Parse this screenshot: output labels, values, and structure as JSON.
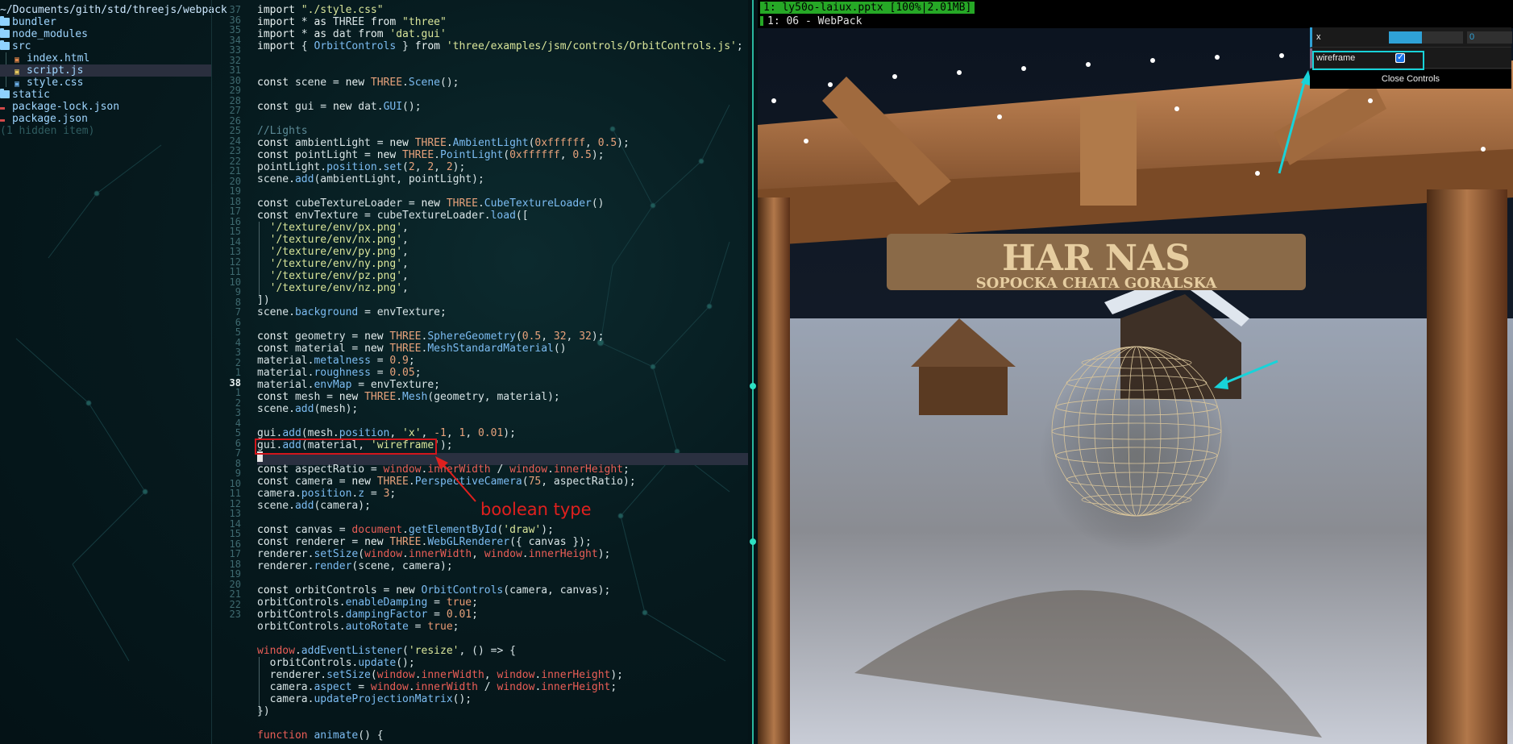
{
  "file_tree": {
    "root": "~/Documents/gith/std/threejs/webpack",
    "items": [
      {
        "label": "bundler",
        "kind": "folder"
      },
      {
        "label": "node_modules",
        "kind": "folder"
      },
      {
        "label": "src",
        "kind": "folder"
      },
      {
        "label": "index.html",
        "kind": "file"
      },
      {
        "label": "script.js",
        "kind": "file",
        "selected": true
      },
      {
        "label": "style.css",
        "kind": "file"
      },
      {
        "label": "static",
        "kind": "folder"
      },
      {
        "label": "package-lock.json",
        "kind": "file"
      },
      {
        "label": "package.json",
        "kind": "file"
      }
    ],
    "hidden_note": "(1 hidden item)"
  },
  "editor": {
    "line_numbers": [
      "37",
      "36",
      "35",
      "34",
      "33",
      "32",
      "31",
      "30",
      "29",
      "28",
      "27",
      "26",
      "25",
      "24",
      "23",
      "22",
      "21",
      "20",
      "19",
      "18",
      "17",
      "16",
      "15",
      "14",
      "13",
      "12",
      "11",
      "10",
      "9",
      "8",
      "7",
      "6",
      "5",
      "4",
      "3",
      "2",
      "1",
      "38",
      "1",
      "2",
      "3",
      "4",
      "5",
      "6",
      "7",
      "8",
      "9",
      "10",
      "11",
      "12",
      "13",
      "14",
      "15",
      "16",
      "17",
      "18",
      "19",
      "20",
      "21",
      "22",
      "23"
    ],
    "current_line_index": 37
  },
  "annotation": {
    "label": "boolean type"
  },
  "preview": {
    "status": "1: ly50o-laiux.pptx [100%|2.01MB]",
    "window_title": "1: 06 - WebPack"
  },
  "gui": {
    "x_label": "x",
    "x_value": "0",
    "x_fraction": 0.45,
    "wireframe_label": "wireframe",
    "wireframe_checked": true,
    "close_label": "Close Controls"
  },
  "scene": {
    "sign_title": "HAR NAS",
    "sign_subtitle": "SOPOCKA CHATA GORALSKA"
  }
}
